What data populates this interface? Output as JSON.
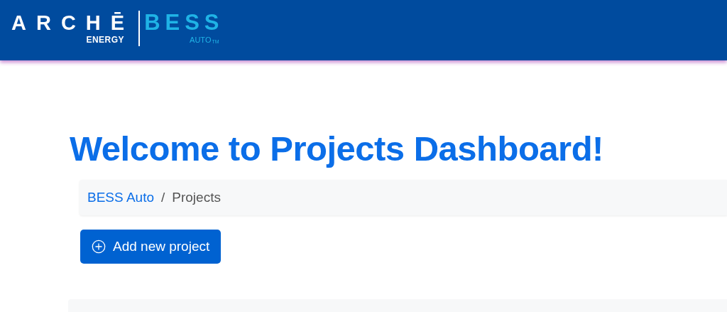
{
  "header": {
    "logo": {
      "brand": "ARCHĒ",
      "brand_sub": "ENERGY",
      "product": "BESS",
      "product_sub": "AUTO",
      "trademark": "TM"
    }
  },
  "heading": "Welcome to Projects Dashboard!",
  "breadcrumb": [
    {
      "label": "BESS Auto",
      "kind": "link"
    },
    {
      "label": "Projects",
      "kind": "current"
    }
  ],
  "separator": "/",
  "add_button": {
    "label": "Add new project"
  }
}
